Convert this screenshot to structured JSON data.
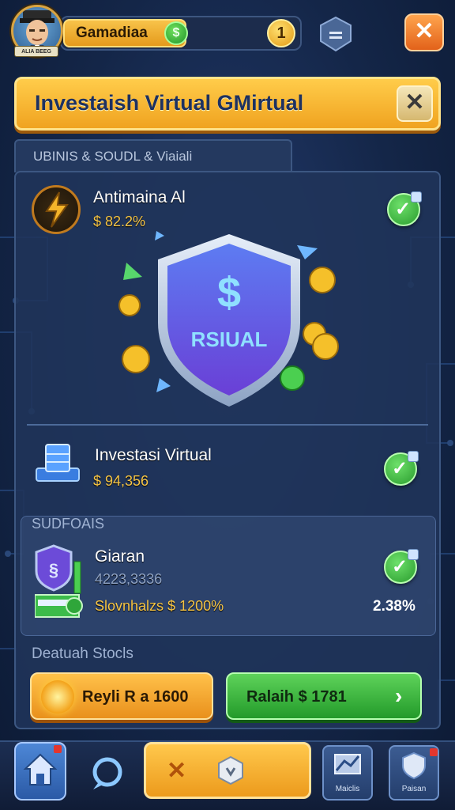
{
  "header": {
    "player_name": "Gamadiaa",
    "avatar_tag": "ALIA BEEG",
    "dollar_symbol": "$",
    "coin_count": "1",
    "close_symbol": "✕"
  },
  "banner": {
    "title": "Investaish Virtual  GMirtual",
    "close_symbol": "✕"
  },
  "section_tab": {
    "label": "UBINIS & SOUDL & Viaiali"
  },
  "items": [
    {
      "title": "Antimaina Al",
      "value": "$ 82.2%"
    },
    {
      "title": "Investasi Virtual",
      "value": "$ 94,356"
    }
  ],
  "hero": {
    "symbol": "$",
    "label": "RSIUAL"
  },
  "subsection": {
    "header": "SUDFOAIS",
    "title": "Giaran",
    "subtitle": "4223,3336",
    "yield_label": "Slovnhalzs $ 1200%",
    "rate": "2.38%"
  },
  "footer_label": "Deatuah Stocls",
  "buttons": {
    "buy_label": "Reyli R a 1600",
    "confirm_label": "Ralaih $ 1781",
    "chevron": "›"
  },
  "bottom_nav": {
    "close_symbol": "✕",
    "tile_market_caption": "Maiclis",
    "tile_defense_caption": "Paisan"
  },
  "colors": {
    "accent_gold": "#f5c445",
    "accent_green": "#2a9c2e",
    "panel_blue": "#20345a"
  },
  "icons": [
    "home-icon",
    "chat-icon",
    "shield-icon",
    "check-icon",
    "bolt-icon",
    "cube-icon",
    "sun-icon",
    "chevron-right-icon"
  ]
}
